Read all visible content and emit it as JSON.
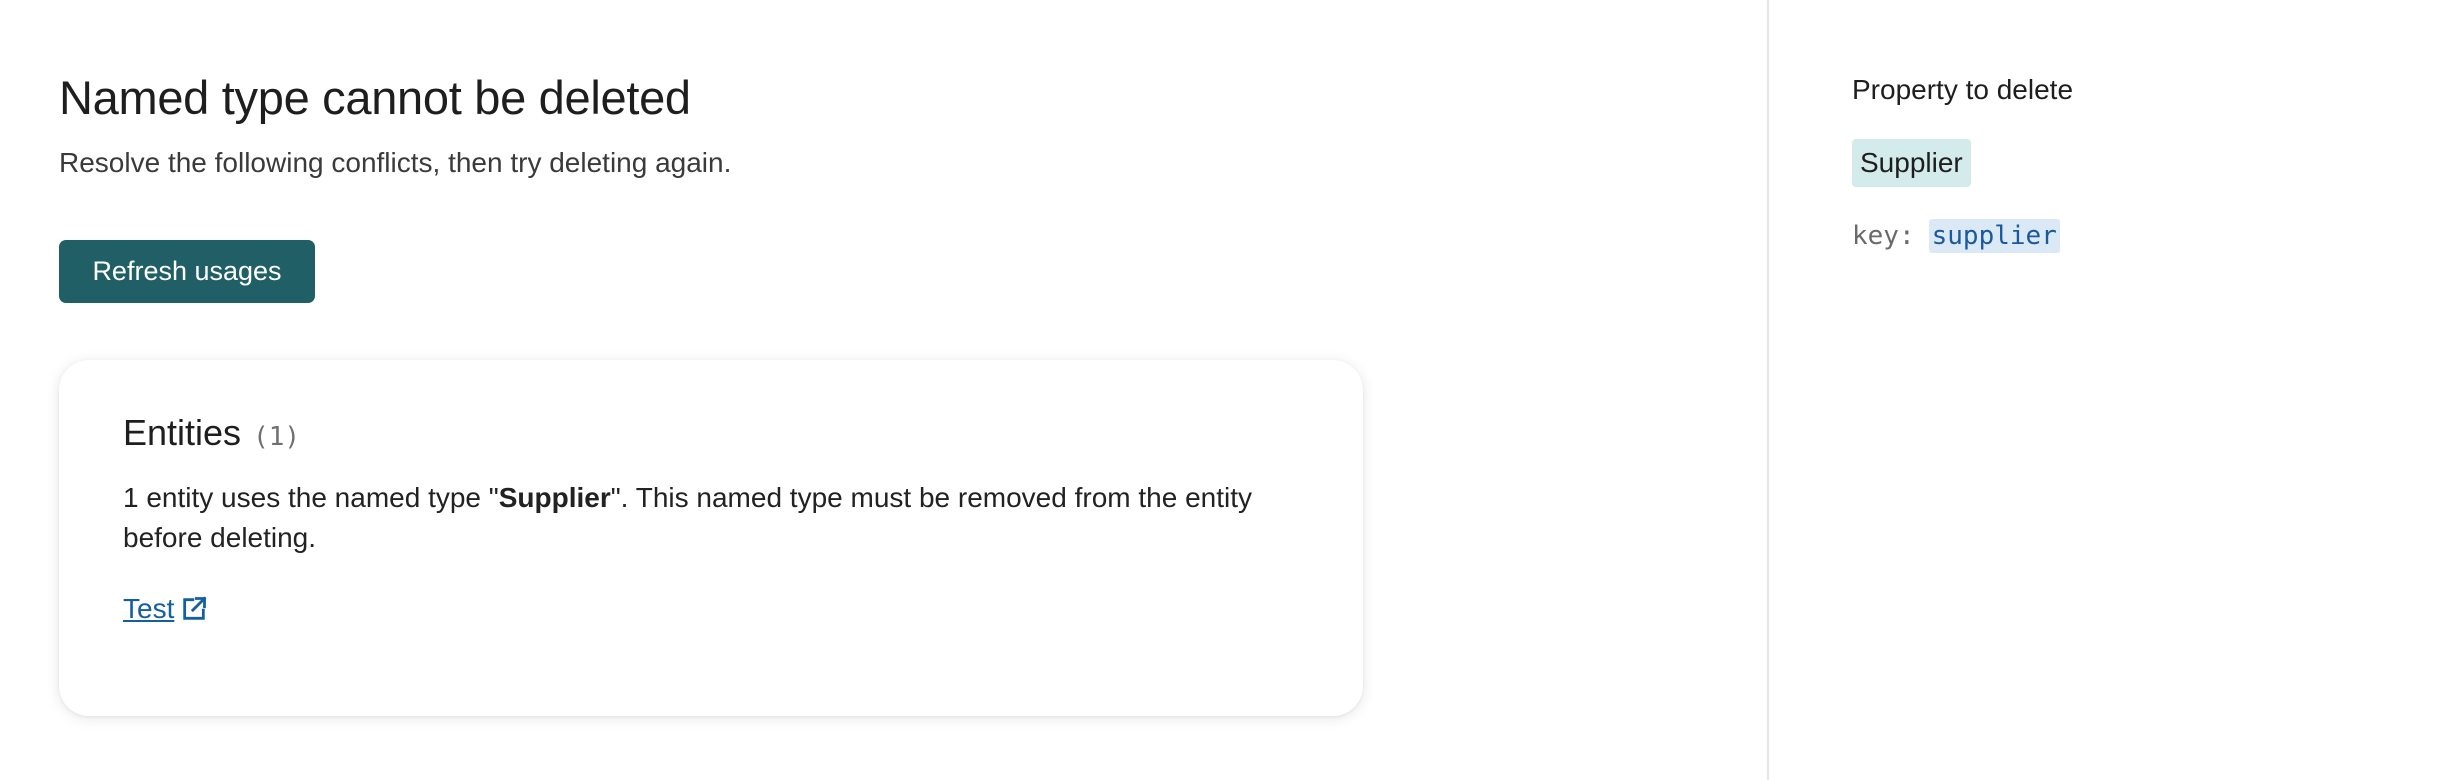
{
  "main": {
    "title": "Named type cannot be deleted",
    "subtitle": "Resolve the following conflicts, then try deleting again.",
    "refresh_label": "Refresh usages",
    "card": {
      "title": "Entities",
      "count": "(1)",
      "desc_prefix": "1 entity uses the named type \"",
      "desc_bold": "Supplier",
      "desc_suffix": "\". This named type must be removed from the entity before deleting.",
      "link_label": "Test",
      "link_icon": "external-link-icon"
    }
  },
  "side": {
    "label": "Property to delete",
    "chip": "Supplier",
    "key_label": "key:",
    "key_value": "supplier"
  },
  "colors": {
    "primary_button": "#215f66",
    "link": "#14609f",
    "chip_bg": "#d3ebea",
    "code_bg": "#dbe8f5"
  }
}
